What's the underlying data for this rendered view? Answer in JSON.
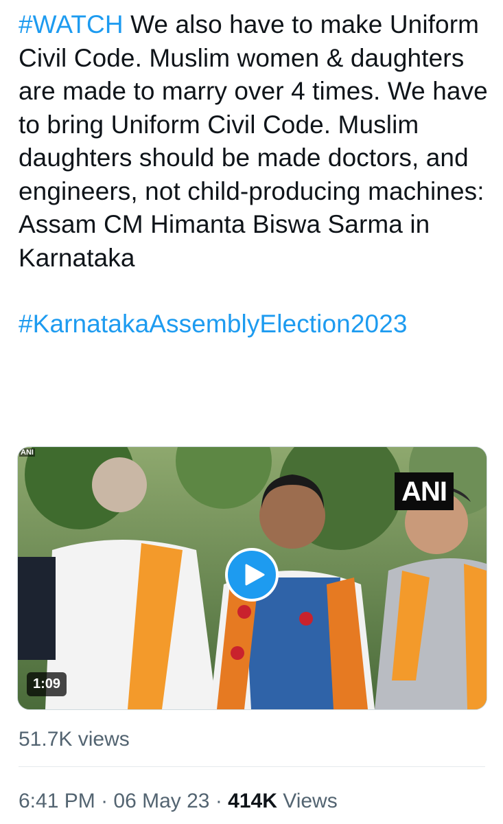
{
  "tweet": {
    "hashtag1": "#WATCH",
    "body": " We also have to make Uniform Civil Code. Muslim women & daughters are made to marry over 4 times. We have to bring Uniform Civil Code. Muslim daughters should be made doctors, and engineers, not child-producing machines: Assam CM Himanta Biswa Sarma in Karnataka",
    "hashtag2": "#KarnatakaAssemblyElection2023"
  },
  "media": {
    "logo": "ANI",
    "corner_mark": "ANI",
    "duration": "1:09",
    "play_icon": "play-icon"
  },
  "video_views": "51.7K views",
  "meta": {
    "time": "6:41 PM",
    "sep1": " · ",
    "date": "06 May 23",
    "sep2": " · ",
    "views_count": "414K",
    "views_label": " Views"
  },
  "colors": {
    "link": "#1d9bf0",
    "text": "#0f1419",
    "secondary": "#536471"
  }
}
